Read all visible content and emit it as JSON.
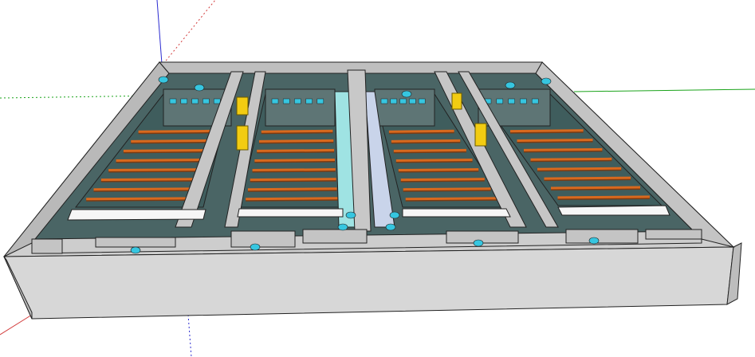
{
  "scene": {
    "description_visible_text": "",
    "axes": {
      "red": "#d23a3a",
      "green": "#1aa31a",
      "blue": "#2a2ad0"
    },
    "colors": {
      "concrete_top": "#c9c9c9",
      "concrete_side": "#d7d7d7",
      "concrete_dark": "#a8a8a8",
      "water": "#3f5d5d",
      "water_light": "#9fe3e3",
      "pipe_orange": "#d8691e",
      "pipe_dark": "#7a3a12",
      "yellow": "#f2cc12",
      "cyan_equipment": "#36c6e0",
      "white_channel": "#f6f6f6",
      "outline": "#222222"
    },
    "icons": [
      "tank-icon",
      "pump-icon",
      "pipe-icon"
    ]
  }
}
